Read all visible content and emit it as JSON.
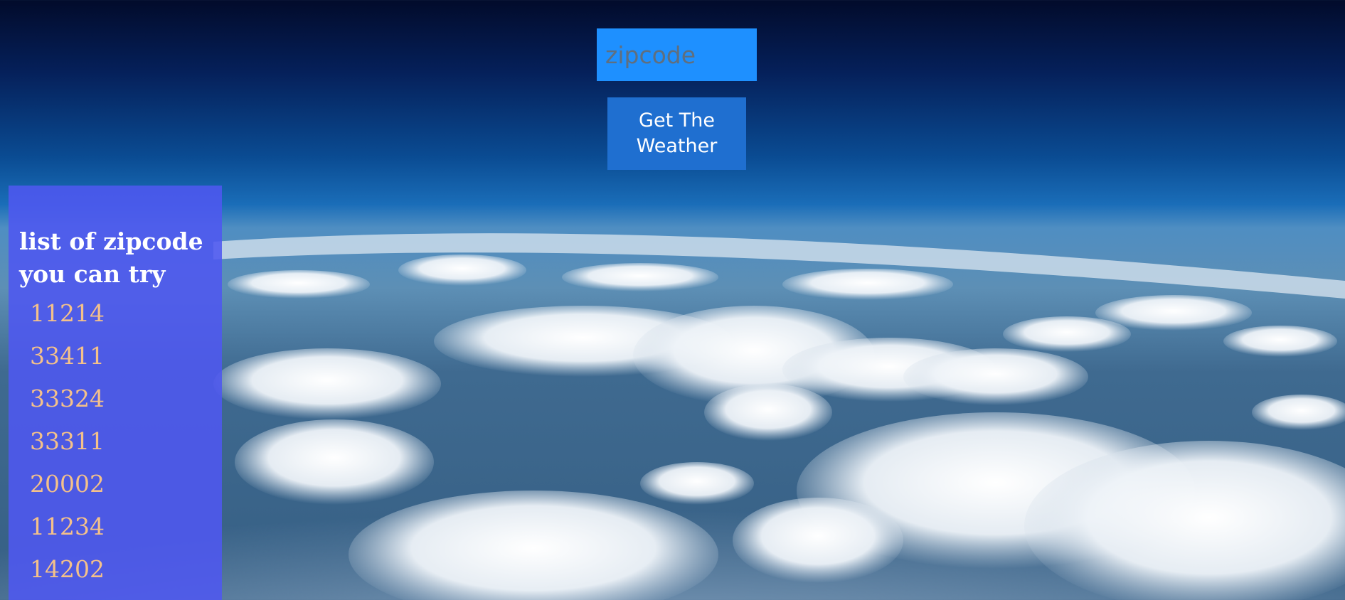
{
  "search": {
    "placeholder": "zipcode",
    "value": ""
  },
  "actions": {
    "get_weather_label": "Get The Weather"
  },
  "zip_panel": {
    "title": "list of zipcode you can try",
    "zipcodes": [
      "11214",
      "33411",
      "33324",
      "33311",
      "20002",
      "11234",
      "14202"
    ]
  },
  "colors": {
    "input_background": "#1e90ff",
    "button_background": "#1f6fd0",
    "panel_background": "#4e58f0",
    "zipcode_text": "#f4c18a",
    "title_text": "#ffffff"
  }
}
